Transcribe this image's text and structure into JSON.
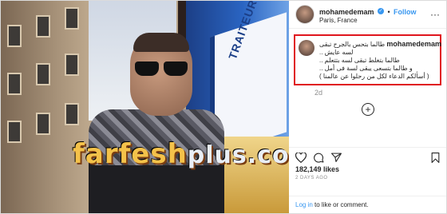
{
  "header": {
    "username": "mohamedemam",
    "verified_symbol": "✓",
    "separator": "•",
    "follow_label": "Follow",
    "location": "Paris, France",
    "more_symbol": "···"
  },
  "caption": {
    "username": "mohamedemam",
    "lines": [
      "طالما بتحس بالجرح تبقى",
      "لسه عايش ..",
      "طالما بتغلط تبقى لسه بتتعلم ..",
      "و طالما بتسعى يبقى لسة فى أمل ..",
      "( أسألكم الدعاء لكل من رحلوا عن عالمنا )"
    ],
    "time": "2d"
  },
  "photo": {
    "shop_sign": "TRAITEUR",
    "watermark_main": "farfesh",
    "watermark_suffix": "plus.com"
  },
  "stats": {
    "likes": "182,149 likes",
    "time_ago": "2 DAYS AGO"
  },
  "login": {
    "link": "Log in",
    "rest": " to like or comment."
  },
  "icons": [
    "heart-icon",
    "comment-icon",
    "share-icon",
    "bookmark-icon",
    "add-comment-icon"
  ],
  "colors": {
    "accent": "#3897f0",
    "highlight": "#e0161e"
  }
}
